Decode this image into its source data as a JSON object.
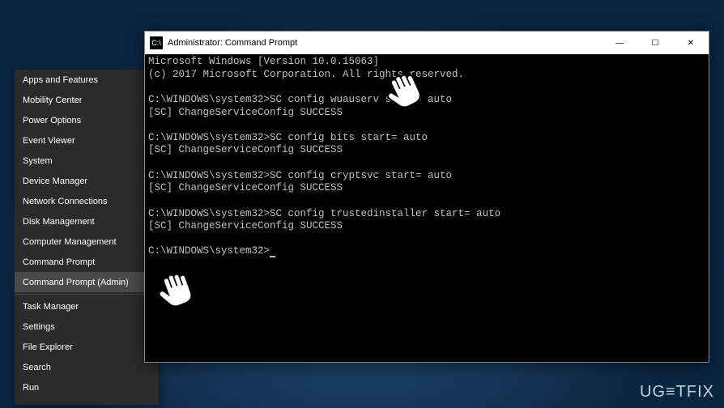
{
  "menu": {
    "items": [
      {
        "label": "Apps and Features"
      },
      {
        "label": "Mobility Center"
      },
      {
        "label": "Power Options"
      },
      {
        "label": "Event Viewer"
      },
      {
        "label": "System"
      },
      {
        "label": "Device Manager"
      },
      {
        "label": "Network Connections"
      },
      {
        "label": "Disk Management"
      },
      {
        "label": "Computer Management"
      },
      {
        "label": "Command Prompt"
      },
      {
        "label": "Command Prompt (Admin)"
      }
    ],
    "items2": [
      {
        "label": "Task Manager"
      },
      {
        "label": "Settings"
      },
      {
        "label": "File Explorer"
      },
      {
        "label": "Search"
      },
      {
        "label": "Run"
      }
    ],
    "selected_index": 10
  },
  "cmd": {
    "title": "Administrator: Command Prompt",
    "icon_glyph": "C:\\",
    "lines": [
      "Microsoft Windows [Version 10.0.15063]",
      "(c) 2017 Microsoft Corporation. All rights reserved.",
      "",
      "C:\\WINDOWS\\system32>SC config wuauserv start= auto",
      "[SC] ChangeServiceConfig SUCCESS",
      "",
      "C:\\WINDOWS\\system32>SC config bits start= auto",
      "[SC] ChangeServiceConfig SUCCESS",
      "",
      "C:\\WINDOWS\\system32>SC config cryptsvc start= auto",
      "[SC] ChangeServiceConfig SUCCESS",
      "",
      "C:\\WINDOWS\\system32>SC config trustedinstaller start= auto",
      "[SC] ChangeServiceConfig SUCCESS",
      "",
      "C:\\WINDOWS\\system32>"
    ],
    "prompt_current": "C:\\WINDOWS\\system32>"
  },
  "controls": {
    "minimize": "—",
    "maximize": "☐",
    "close": "✕"
  },
  "watermark": "UG≡TFIX"
}
